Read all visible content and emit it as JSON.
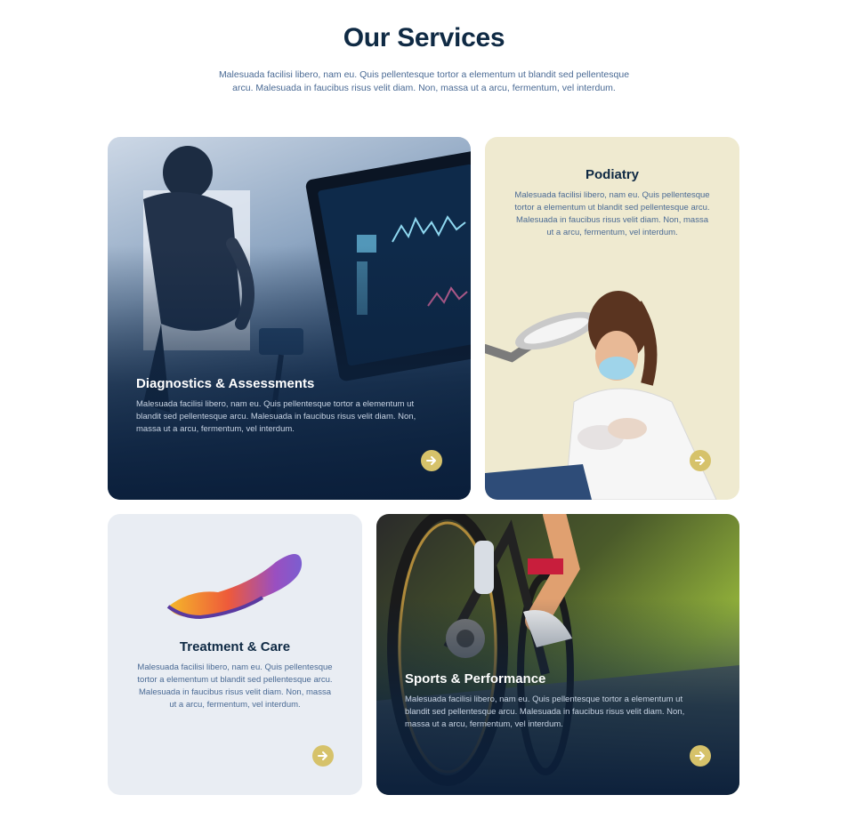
{
  "section": {
    "title": "Our Services",
    "intro": "Malesuada facilisi libero, nam eu. Quis pellentesque tortor a elementum ut blandit sed pellentesque arcu. Malesuada in faucibus risus velit diam. Non, massa ut a arcu, fermentum, vel interdum."
  },
  "cards": [
    {
      "title": "Diagnostics & Assessments",
      "text": "Malesuada facilisi libero, nam eu. Quis pellentesque tortor a elementum ut blandit sed pellentesque arcu. Malesuada in faucibus risus velit diam. Non, massa ut a arcu, fermentum, vel interdum.",
      "icon": "arrow-right-icon"
    },
    {
      "title": "Podiatry",
      "text": "Malesuada facilisi libero, nam eu. Quis pellentesque tortor a elementum ut blandit sed pellentesque arcu. Malesuada in faucibus risus velit diam. Non, massa ut a arcu, fermentum, vel interdum.",
      "icon": "arrow-right-icon"
    },
    {
      "title": "Treatment & Care",
      "text": "Malesuada facilisi libero, nam eu. Quis pellentesque tortor a elementum ut blandit sed pellentesque arcu. Malesuada in faucibus risus velit diam. Non, massa ut a arcu, fermentum, vel interdum.",
      "icon": "arrow-right-icon"
    },
    {
      "title": "Sports & Performance",
      "text": "Malesuada facilisi libero, nam eu. Quis pellentesque tortor a elementum ut blandit sed pellentesque arcu. Malesuada in faucibus risus velit diam. Non, massa ut a arcu, fermentum, vel interdum.",
      "icon": "arrow-right-icon"
    }
  ],
  "colors": {
    "heading": "#0f2a44",
    "body_text": "#4a6a94",
    "accent_button": "#d6c26a",
    "podiatry_bg": "#efead0",
    "treatment_bg": "#e9edf3"
  }
}
